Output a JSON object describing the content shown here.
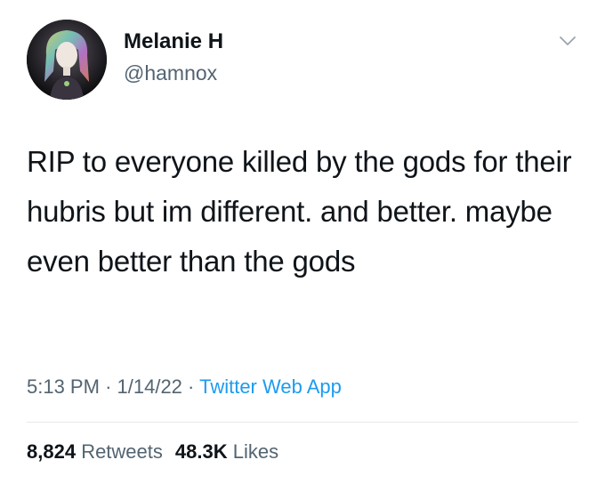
{
  "author": {
    "name": "Melanie H",
    "handle": "@hamnox"
  },
  "tweet": {
    "text": "RIP to everyone killed by the gods for their hubris but im different. and better. maybe even better than the gods"
  },
  "meta": {
    "time": "5:13 PM",
    "separator": "·",
    "date": "1/14/22",
    "source": "Twitter Web App"
  },
  "stats": {
    "retweets": "8,824",
    "retweets_label": "Retweets",
    "likes": "48.3K",
    "likes_label": "Likes"
  },
  "icons": {
    "more": "chevron-down-icon"
  },
  "colors": {
    "text": "#0f1419",
    "secondary": "#536471",
    "link": "#1d9bf0",
    "divider": "#e7e9eb"
  }
}
